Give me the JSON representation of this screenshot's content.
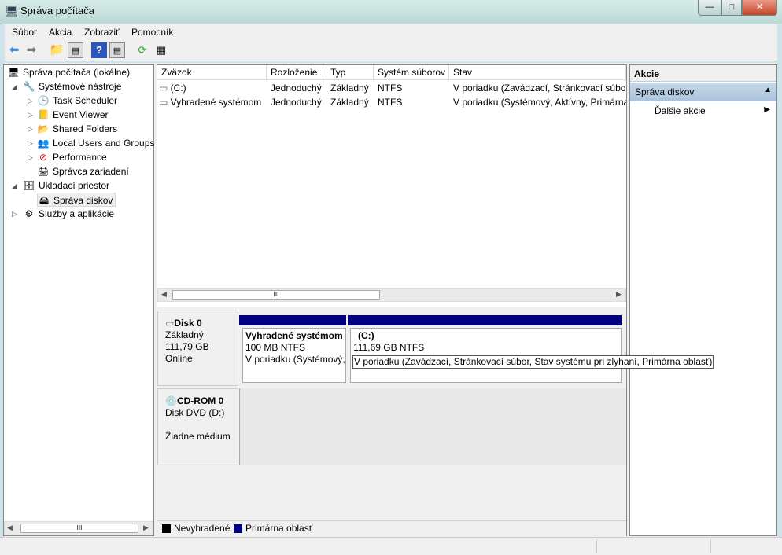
{
  "window": {
    "title": "Správa počítača",
    "minimize": "—",
    "maximize": "□",
    "close": "✕"
  },
  "menu": [
    "Súbor",
    "Akcia",
    "Zobraziť",
    "Pomocník"
  ],
  "toolbar": [
    "back-icon",
    "forward-icon",
    "up-folder-icon",
    "show-hide-tree-icon",
    "help-icon",
    "show-hide-action-pane-icon",
    "refresh-icon",
    "properties-icon"
  ],
  "tree": {
    "root": "Správa počítača (lokálne)",
    "system_tools": "Systémové nástroje",
    "task_scheduler": "Task Scheduler",
    "event_viewer": "Event Viewer",
    "shared_folders": "Shared Folders",
    "local_users": "Local Users and Groups",
    "performance": "Performance",
    "device_manager": "Správca zariadení",
    "storage": "Ukladací priestor",
    "disk_mgmt": "Správa diskov",
    "services": "Služby a aplikácie"
  },
  "volumes": {
    "columns": [
      "Zväzok",
      "Rozloženie",
      "Typ",
      "Systém súborov",
      "Stav"
    ],
    "rows": [
      [
        "(C:)",
        "Jednoduchý",
        "Základný",
        "NTFS",
        "V poriadku (Zavádzací, Stránkovací súbor,"
      ],
      [
        "Vyhradené systémom",
        "Jednoduchý",
        "Základný",
        "NTFS",
        "V poriadku (Systémový, Aktívny, Primárna"
      ]
    ],
    "scroll_grip": "III"
  },
  "disks": {
    "disk0": {
      "name": "Disk 0",
      "type": "Základný",
      "size": "111,79 GB",
      "status": "Online",
      "partitions": [
        {
          "name": "Vyhradené systémom",
          "size": "100 MB NTFS",
          "status": "V poriadku (Systémový,"
        },
        {
          "name": "(C:)",
          "size": "111,69 GB NTFS",
          "status": "V poriadku (Zavádzací, Stránkovací súbor, Stav systému pri zlyhaní, Primárna oblasť)"
        }
      ]
    },
    "cdrom0": {
      "name": "CD-ROM 0",
      "type": "Disk DVD (D:)",
      "status": "Žiadne médium"
    }
  },
  "legend": [
    {
      "label": "Nevyhradené",
      "color": "#000000"
    },
    {
      "label": "Primárna oblasť",
      "color": "#000080"
    }
  ],
  "actions": {
    "header": "Akcie",
    "section": "Správa diskov",
    "more": "Ďalšie akcie"
  },
  "left_scroll_grip": "III"
}
